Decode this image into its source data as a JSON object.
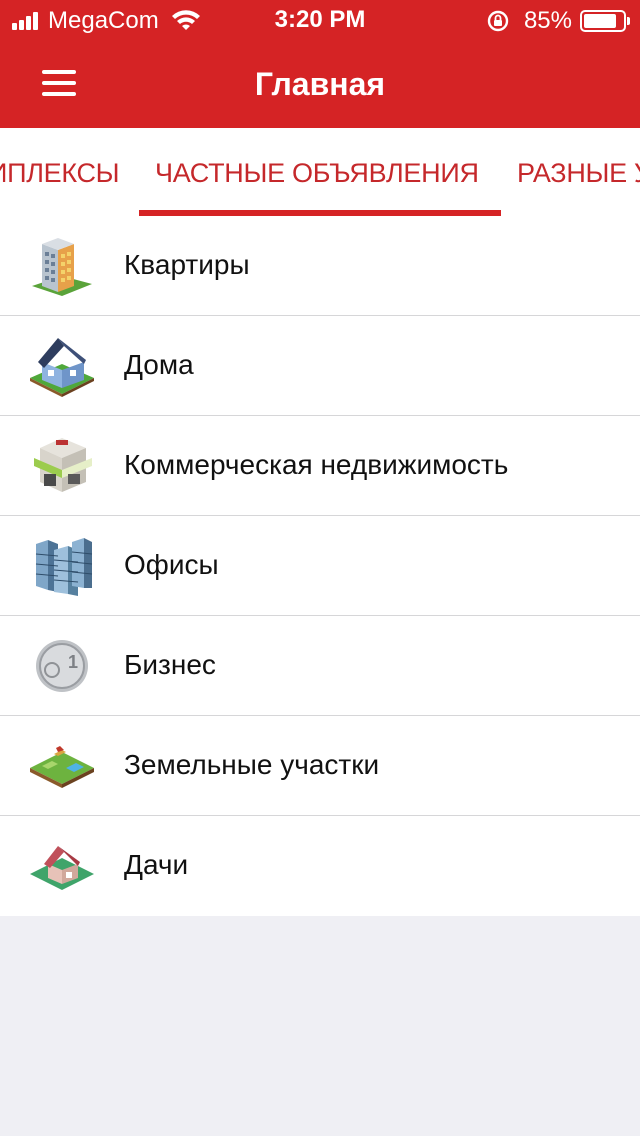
{
  "status_bar": {
    "carrier": "MegaCom",
    "time": "3:20 PM",
    "battery_percent": "85%",
    "battery_level": 0.85,
    "signal_icon": "signal-bars-icon",
    "wifi_icon": "wifi-icon",
    "lock_icon": "orientation-lock-icon"
  },
  "navbar": {
    "title": "Главная",
    "menu_icon": "hamburger-menu-icon"
  },
  "tabs": [
    {
      "label": "ИПЛЕКСЫ"
    },
    {
      "label": "ЧАСТНЫЕ ОБЪЯВЛЕНИЯ",
      "selected": true
    },
    {
      "label": "РАЗНЫЕ УС"
    }
  ],
  "categories": [
    {
      "label": "Квартиры",
      "icon": "apartment-building-icon"
    },
    {
      "label": "Дома",
      "icon": "house-icon"
    },
    {
      "label": "Коммерческая недвижимость",
      "icon": "storefront-icon"
    },
    {
      "label": "Офисы",
      "icon": "office-towers-icon"
    },
    {
      "label": "Бизнес",
      "icon": "coin-icon"
    },
    {
      "label": "Земельные участки",
      "icon": "land-plot-icon"
    },
    {
      "label": "Дачи",
      "icon": "cottage-icon"
    }
  ],
  "colors": {
    "brand": "#d52325",
    "tab_text": "#c5282b",
    "background": "#efeff4"
  }
}
